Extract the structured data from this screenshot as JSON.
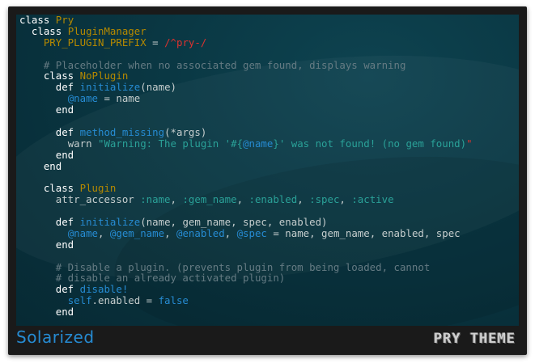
{
  "footer": {
    "theme_name": "Solarized",
    "logo_text": "PRY THEME"
  },
  "colors": {
    "background": "#0a3844",
    "keyword": "#ffffff",
    "class_name": "#b58900",
    "method_name": "#268bd2",
    "instance_var": "#268bd2",
    "symbol": "#2aa198",
    "string": "#2aa198",
    "regex": "#dc322f",
    "comment": "#657b83",
    "footer_theme_name": "#268bd2"
  },
  "code": {
    "l1": {
      "k": "class",
      "name": "Pry"
    },
    "l2": {
      "k": "class",
      "name": "PluginManager"
    },
    "l3": {
      "const": "PRY_PLUGIN_PREFIX",
      "op": " = ",
      "re": "/^pry-/"
    },
    "l5": {
      "cmt": "# Placeholder when no associated gem found, displays warning"
    },
    "l6": {
      "k": "class",
      "name": "NoPlugin"
    },
    "l7": {
      "k": "def",
      "fn": "initialize",
      "args": "(name)"
    },
    "l8": {
      "ivar": "@name",
      "rest": " = name"
    },
    "l9": {
      "k": "end"
    },
    "l11": {
      "k": "def",
      "fn": "method_missing",
      "args": "(*args)"
    },
    "l12": {
      "call": "warn ",
      "str1": "\"Warning: The plugin '#{",
      "ivar": "@name",
      "str2": "}' was not found! (no gem found)",
      "q": "\""
    },
    "l13": {
      "k": "end"
    },
    "l14": {
      "k": "end"
    },
    "l16": {
      "k": "class",
      "name": "Plugin"
    },
    "l17": {
      "call": "attr_accessor ",
      "s1": ":name",
      "c1": ", ",
      "s2": ":gem_name",
      "c2": ", ",
      "s3": ":enabled",
      "c3": ", ",
      "s4": ":spec",
      "c4": ", ",
      "s5": ":active"
    },
    "l19": {
      "k": "def",
      "fn": "initialize",
      "args": "(name, gem_name, spec, enabled)"
    },
    "l20": {
      "i1": "@name",
      "c1": ", ",
      "i2": "@gem_name",
      "c2": ", ",
      "i3": "@enabled",
      "c3": ", ",
      "i4": "@spec",
      "rest": " = name, gem_name, enabled, spec"
    },
    "l21": {
      "k": "end"
    },
    "l23": {
      "cmt": "# Disable a plugin. (prevents plugin from being loaded, cannot"
    },
    "l24": {
      "cmt": "# disable an already activated plugin)"
    },
    "l25": {
      "k": "def",
      "fn": "disable!"
    },
    "l26": {
      "self": "self",
      "rest": ".enabled = ",
      "bool": "false"
    },
    "l27": {
      "k": "end"
    }
  }
}
